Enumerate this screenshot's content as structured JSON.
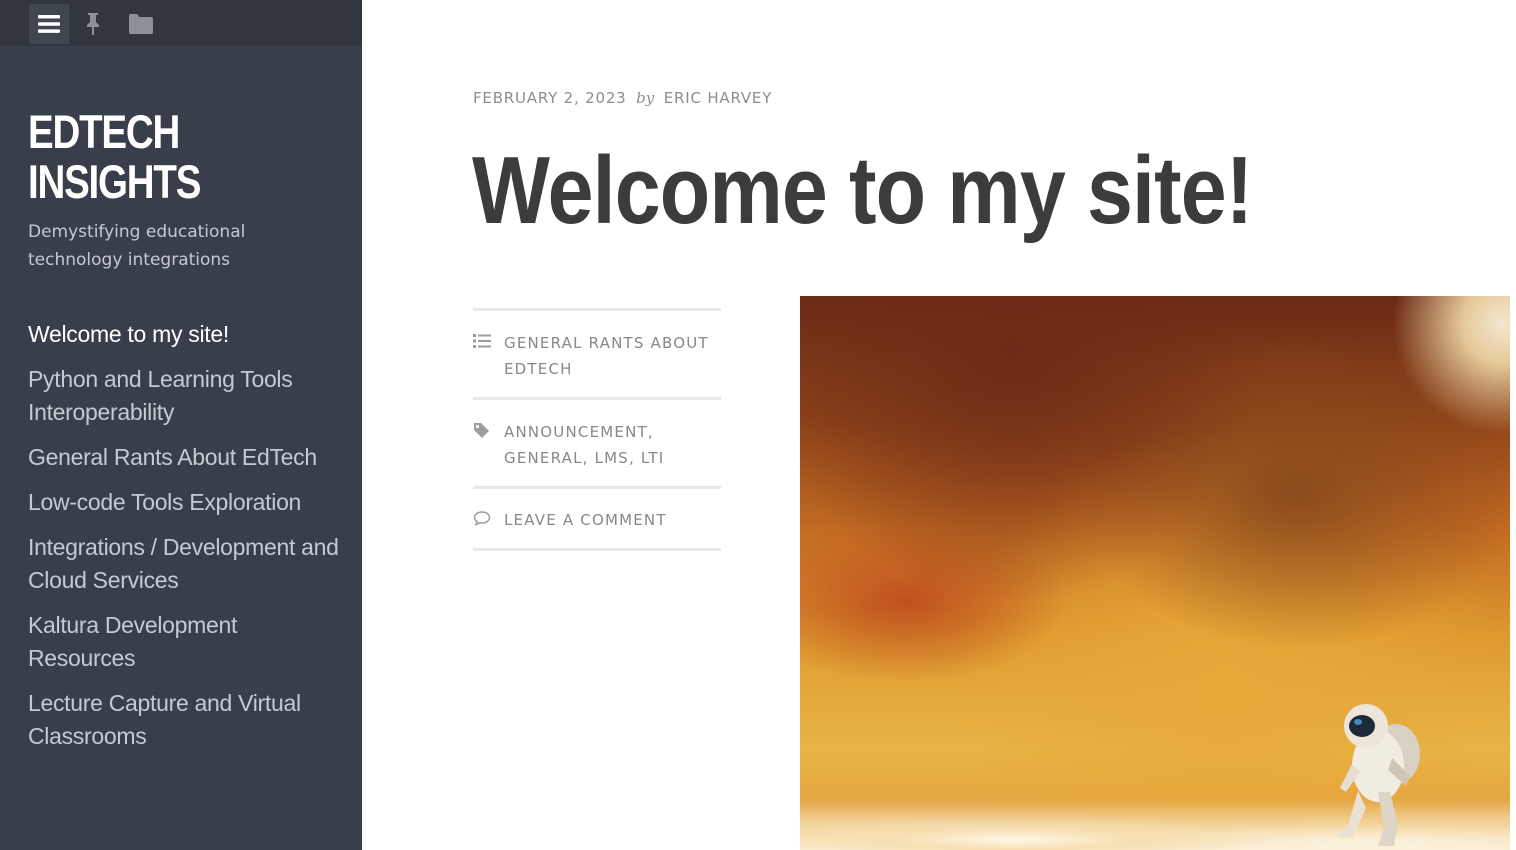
{
  "toolbar": {
    "icons": [
      "menu-icon",
      "pin-icon",
      "folder-icon"
    ]
  },
  "site": {
    "title_line1": "EDTECH",
    "title_line2": "INSIGHTS",
    "description_line1": "Demystifying educational",
    "description_line2": "technology integrations"
  },
  "nav": {
    "items": [
      {
        "line1": "Welcome to my site!",
        "line2": ""
      },
      {
        "line1": "Python and Learning Tools",
        "line2": "Interoperability"
      },
      {
        "line1": "General Rants About EdTech",
        "line2": ""
      },
      {
        "line1": "Low-code Tools Exploration",
        "line2": ""
      },
      {
        "line1": "Integrations / Development and",
        "line2": "Cloud Services"
      },
      {
        "line1": "Kaltura Development Resources",
        "line2": ""
      },
      {
        "line1": "Lecture Capture and Virtual",
        "line2": "Classrooms"
      }
    ]
  },
  "post": {
    "date": "FEBRUARY 2, 2023",
    "by": "by",
    "author": "ERIC HARVEY",
    "title": "Welcome to my site!",
    "category_line1": "GENERAL RANTS ABOUT",
    "category_line2": "EDTECH",
    "tags_line1": "ANNOUNCEMENT,",
    "tags_line2": "GENERAL, LMS, LTI",
    "comment_link": "LEAVE A COMMENT"
  },
  "colors": {
    "sidebar_bg": "#393f4a",
    "topbar_bg": "#32373f",
    "meta_text": "#85888c",
    "title_text": "#3c3c3c"
  }
}
